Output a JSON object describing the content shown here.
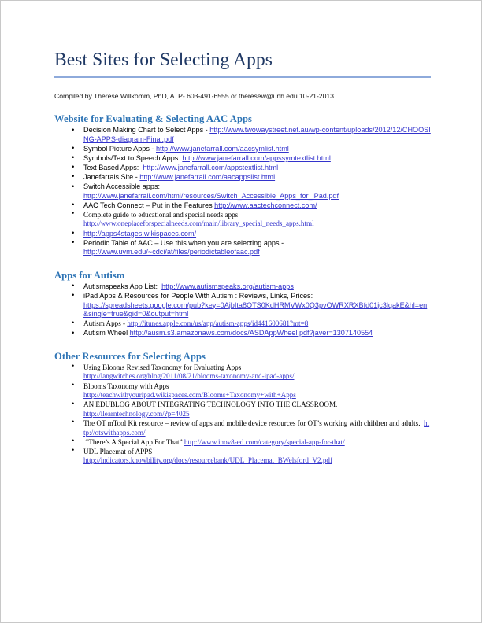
{
  "document": {
    "title": "Best Sites for Selecting Apps",
    "byline": "Compiled by Therese Willkomm, PhD, ATP- 603-491-6555 or theresew@unh.edu 10-21-2013",
    "colors": {
      "title": "#1F3864",
      "rule": "#8EAADB",
      "heading": "#2E74B5",
      "link": "#3333CC",
      "body": "#000000"
    }
  },
  "sections": [
    {
      "heading": "Website for Evaluating & Selecting AAC Apps",
      "items": [
        {
          "font": "sans",
          "text": "Decision Making Chart to Select Apps - ",
          "link": "http://www.twowaystreet.net.au/wp-content/uploads/2012/12/CHOOSING-APPS-diagram-Final.pdf",
          "after": ""
        },
        {
          "font": "sans",
          "text": "Symbol Picture Apps - ",
          "link": "http://www.janefarrall.com/aacsymlist.html",
          "after": ""
        },
        {
          "font": "sans",
          "text": "Symbols/Text to Speech Apps: ",
          "link": "http://www.janefarrall.com/appssymtextlist.html",
          "after": ""
        },
        {
          "font": "sans",
          "text": "Text Based Apps:  ",
          "link": "http://www.janefarrall.com/appstextlist.html",
          "after": ""
        },
        {
          "font": "sans",
          "text": "Janefarrals Site - ",
          "link": "http://www.janefarrall.com/aacappslist.html",
          "after": ""
        },
        {
          "font": "sans",
          "text": "Switch Accessible apps:\n",
          "link": "http://www.janefarrall.com/html/resources/Switch_Accessible_Apps_for_iPad.pdf",
          "after": ""
        },
        {
          "font": "sans",
          "text": "AAC Tech Connect – Put in the Features ",
          "link": "http://www.aactechconnect.com/",
          "after": ""
        },
        {
          "font": "serif",
          "text": "Complete guide to educational and special needs apps\n",
          "link": "http://www.oneplaceforspecialneeds.com/main/library_special_needs_apps.html",
          "after": ""
        },
        {
          "font": "sans",
          "text": "",
          "link": "http://apps4stages.wikispaces.com/",
          "after": ""
        },
        {
          "font": "sans",
          "text": "Periodic Table of AAC – Use this when you are selecting apps - \n",
          "link": "http://www.uvm.edu/~cdci/at/files/periodictableofaac.pdf",
          "after": ""
        }
      ]
    },
    {
      "heading": "Apps for Autism",
      "items": [
        {
          "font": "sans",
          "text": "Autismspeaks App List:  ",
          "link": "http://www.autismspeaks.org/autism-apps",
          "after": ""
        },
        {
          "font": "sans",
          "text": "iPad Apps & Resources for People With Autism : Reviews, Links, Prices:\n",
          "link": "https://spreadsheets.google.com/pub?key=0AjbIta8OTS0KdHRMVWx0Q3pvOWRXRXBfd01jc3lqakE&hl=en&single=true&gid=0&output=html",
          "after": ""
        },
        {
          "font": "serif",
          "text": "Autism Apps - ",
          "link": "http://itunes.apple.com/us/app/autism-apps/id441600681?mt=8",
          "after": ""
        },
        {
          "font": "sans",
          "text": "Autism Wheel ",
          "link": "http://ausm.s3.amazonaws.com/docs/ASDAppWheel.pdf?javer=1307140554",
          "after": ""
        }
      ]
    },
    {
      "heading": "Other Resources for Selecting Apps",
      "items": [
        {
          "font": "serif",
          "text": "Using Blooms Revised Taxonomy for Evaluating Apps\n",
          "link": "http://langwitches.org/blog/2011/08/21/blooms-taxonomy-and-ipad-apps/",
          "after": ""
        },
        {
          "font": "serif",
          "text": "Blooms Taxonomy with Apps\n",
          "link": "http://teachwithyouripad.wikispaces.com/Blooms+Taxonomy+with+Apps",
          "after": ""
        },
        {
          "font": "serif",
          "text": "AN EDUBLOG ABOUT INTEGRATING TECHNOLOGY INTO THE CLASSROOM.\n",
          "link": "http://ilearntechnology.com/?p=4025",
          "after": ""
        },
        {
          "font": "serif",
          "text": "The OT mTool Kit resource – review of apps and mobile device resources for OT’s working with children and adults.  ",
          "link": "http://otswithapps.com/",
          "after": ""
        },
        {
          "font": "serif",
          "text": " “There’s A Special App For That” ",
          "link": "http://www.inov8-ed.com/category/special-app-for-that/",
          "after": ""
        },
        {
          "font": "serif",
          "text": "UDL Placemat of APPS\n",
          "link": "http://indicators.knowbility.org/docs/resourcebank/UDL_Placemat_BWelsford_V2.pdf",
          "after": ""
        }
      ]
    }
  ]
}
